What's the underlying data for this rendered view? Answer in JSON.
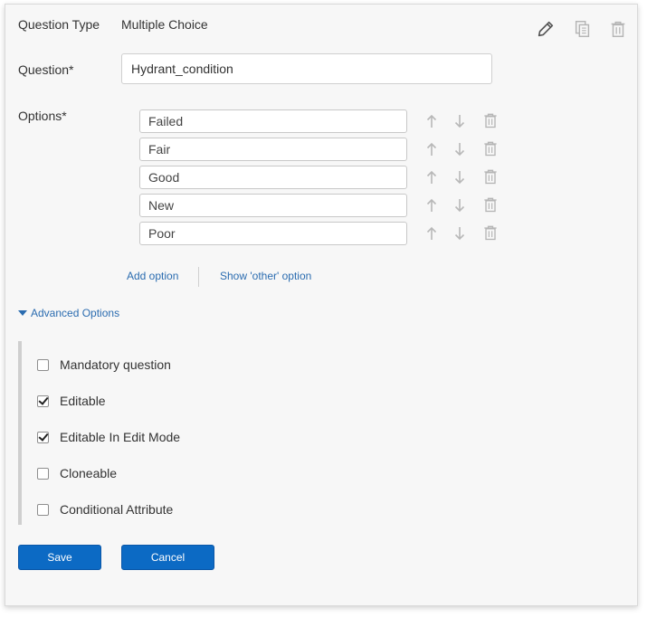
{
  "question_type": {
    "label": "Question Type",
    "value": "Multiple Choice"
  },
  "question": {
    "label": "Question*",
    "value": "Hydrant_condition"
  },
  "toolbar": {
    "edit_icon": "pencil-icon",
    "copy_icon": "copy-icon",
    "delete_icon": "trash-icon"
  },
  "options": {
    "label": "Options*",
    "items": [
      {
        "value": "Failed"
      },
      {
        "value": "Fair"
      },
      {
        "value": "Good"
      },
      {
        "value": "New"
      },
      {
        "value": "Poor"
      }
    ],
    "add_option": "Add option",
    "show_other": "Show 'other' option"
  },
  "advanced": {
    "toggle_label": "Advanced Options",
    "expanded": true,
    "checkboxes": [
      {
        "label": "Mandatory question",
        "checked": false
      },
      {
        "label": "Editable",
        "checked": true
      },
      {
        "label": "Editable In Edit Mode",
        "checked": true
      },
      {
        "label": "Cloneable",
        "checked": false
      },
      {
        "label": "Conditional Attribute",
        "checked": false
      }
    ]
  },
  "buttons": {
    "save": "Save",
    "cancel": "Cancel"
  },
  "colors": {
    "accent": "#0c6ac4",
    "link": "#2b6cb0",
    "panel_bg": "#f7f7f7"
  }
}
